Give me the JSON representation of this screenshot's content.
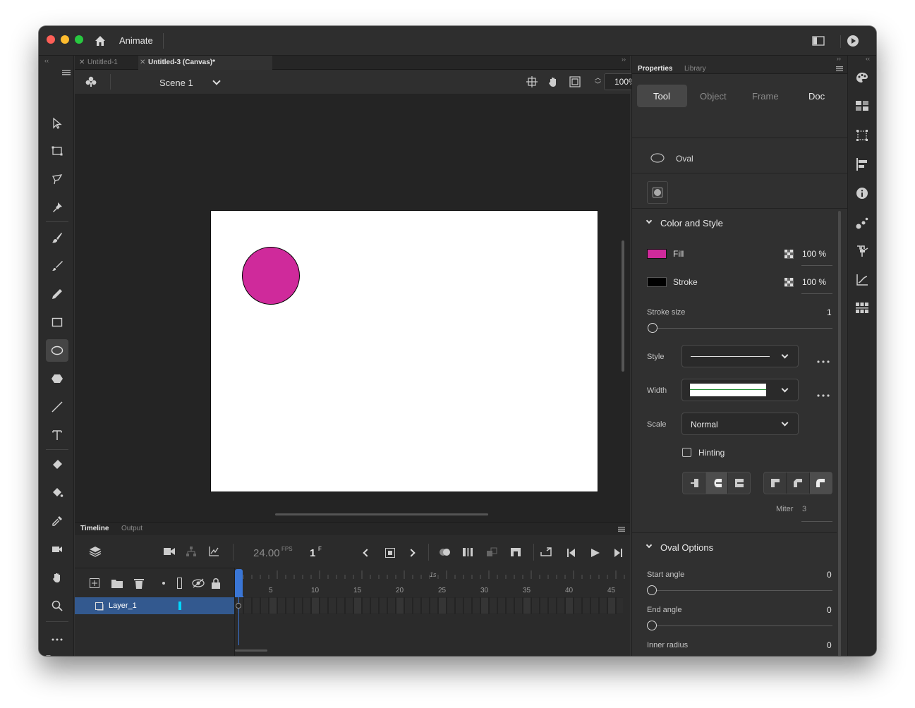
{
  "app": {
    "name": "Animate"
  },
  "document_tabs": [
    {
      "label": "Untitled-1",
      "active": false
    },
    {
      "label": "Untitled-3 (Canvas)*",
      "active": true
    }
  ],
  "scene_bar": {
    "scene_label": "Scene 1",
    "zoom": "100%"
  },
  "stage": {
    "shape_fill": "#cf2a9b",
    "shape_stroke": "#000000"
  },
  "timeline": {
    "tabs": [
      "Timeline",
      "Output"
    ],
    "fps": "24.00",
    "fps_unit": "FPS",
    "frame": "1",
    "frame_unit": "F",
    "second_marker": "1s",
    "ruler": [
      "5",
      "10",
      "15",
      "20",
      "25",
      "30",
      "35",
      "40",
      "45"
    ],
    "layer_name": "Layer_1"
  },
  "properties": {
    "panel_tabs": [
      "Properties",
      "Library"
    ],
    "mode_tabs": [
      "Tool",
      "Object",
      "Frame",
      "Doc"
    ],
    "active_mode": "Tool",
    "tool_name": "Oval",
    "color_style": {
      "heading": "Color and Style",
      "fill_label": "Fill",
      "fill_color": "#cf2a9b",
      "fill_opacity": "100 %",
      "stroke_label": "Stroke",
      "stroke_color": "#000000",
      "stroke_opacity": "100 %",
      "stroke_size_label": "Stroke size",
      "stroke_size_value": "1",
      "style_label": "Style",
      "width_label": "Width",
      "scale_label": "Scale",
      "scale_value": "Normal",
      "hinting_label": "Hinting",
      "miter_label": "Miter",
      "miter_value": "3"
    },
    "oval_options": {
      "heading": "Oval Options",
      "start_angle_label": "Start angle",
      "start_angle_value": "0",
      "end_angle_label": "End angle",
      "end_angle_value": "0",
      "inner_radius_label": "Inner radius",
      "inner_radius_value": "0"
    }
  },
  "tools": [
    "selection-tool",
    "free-transform-tool",
    "lasso-tool",
    "pin-tool",
    "paint-brush-tool",
    "brush-tool",
    "pencil-tool",
    "rectangle-tool",
    "oval-tool",
    "polystar-tool",
    "line-tool",
    "text-tool",
    "eraser-tool",
    "paint-bucket-tool",
    "eyedropper-tool",
    "camera-tool",
    "hand-tool",
    "zoom-tool",
    "more-tools"
  ],
  "colors": {
    "accent": "#3a76d6",
    "fill_swatch": "#cf2a9b"
  }
}
